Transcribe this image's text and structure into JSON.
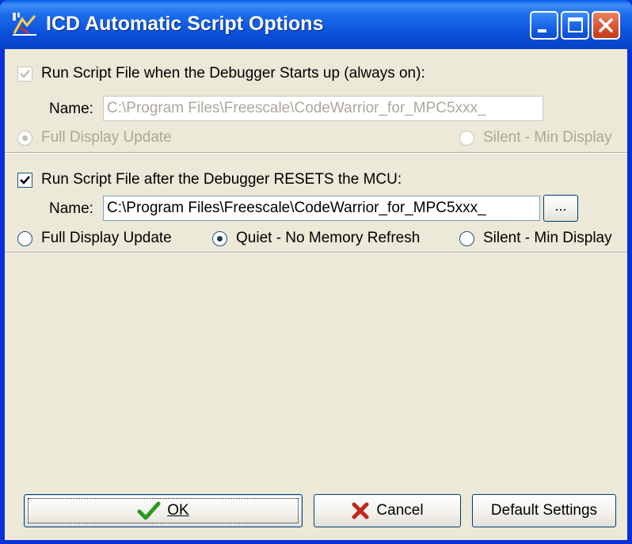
{
  "window": {
    "title": "ICD Automatic Script Options"
  },
  "startup": {
    "checkbox_label": "Run Script File when the Debugger Starts up (always on):",
    "checked": true,
    "name_label": "Name:",
    "name_value": "C:\\Program Files\\Freescale\\CodeWarrior_for_MPC5xxx_",
    "radio_full": "Full Display Update",
    "radio_silent": "Silent - Min Display",
    "selected": "Full Display Update"
  },
  "reset": {
    "checkbox_label": "Run Script File after the Debugger RESETS the MCU:",
    "checked": true,
    "name_label": "Name:",
    "name_value": "C:\\Program Files\\Freescale\\CodeWarrior_for_MPC5xxx_",
    "browse_label": "...",
    "radio_full": "Full Display Update",
    "radio_quiet": "Quiet - No Memory Refresh",
    "radio_silent": "Silent - Min Display",
    "selected": "Quiet - No Memory Refresh"
  },
  "buttons": {
    "ok": "OK",
    "cancel": "Cancel",
    "defaults": "Default Settings"
  },
  "icons": {
    "app": "debugger-app-icon",
    "ok": "green-checkmark-icon",
    "cancel": "red-x-icon"
  },
  "colors": {
    "titlebar": "#0a4fd9",
    "dialog_bg": "#ece9d8",
    "disabled_text": "#aca899",
    "close_button": "#d9532f"
  }
}
